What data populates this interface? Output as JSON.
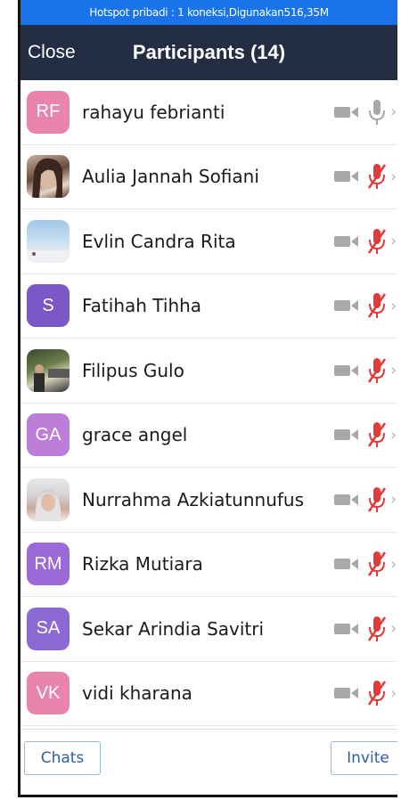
{
  "status_bar": {
    "text": "Hotspot pribadi : 1 koneksi,Digunakan516,35M"
  },
  "header": {
    "close_label": "Close",
    "title": "Participants (14)"
  },
  "participants": [
    {
      "initials": "RF",
      "name": "rahayu febrianti",
      "avatar": "initials",
      "mic": "unmuted"
    },
    {
      "initials": "",
      "name": "Aulia Jannah Sofiani",
      "avatar": "photo",
      "mic": "muted"
    },
    {
      "initials": "",
      "name": "Evlin Candra Rita",
      "avatar": "photo",
      "mic": "muted"
    },
    {
      "initials": "S",
      "name": "Fatihah Tihha",
      "avatar": "initials",
      "mic": "muted"
    },
    {
      "initials": "",
      "name": "Filipus Gulo",
      "avatar": "photo",
      "mic": "muted"
    },
    {
      "initials": "GA",
      "name": "grace angel",
      "avatar": "initials",
      "mic": "muted"
    },
    {
      "initials": "",
      "name": "Nurrahma Azkiatunnufus",
      "avatar": "photo",
      "mic": "muted"
    },
    {
      "initials": "RM",
      "name": "Rizka Mutiara",
      "avatar": "initials",
      "mic": "muted"
    },
    {
      "initials": "SA",
      "name": "Sekar Arindia Savitri",
      "avatar": "initials",
      "mic": "muted"
    },
    {
      "initials": "VK",
      "name": "vidi kharana",
      "avatar": "initials",
      "mic": "muted"
    }
  ],
  "footer": {
    "chats_label": "Chats",
    "invite_label": "Invite"
  },
  "colors": {
    "status_bar": "#1a73e8",
    "header": "#232e45",
    "muted_mic": "#e23b3b",
    "icon_gray": "#a8a8a8",
    "button_text": "#2f5f9a"
  }
}
